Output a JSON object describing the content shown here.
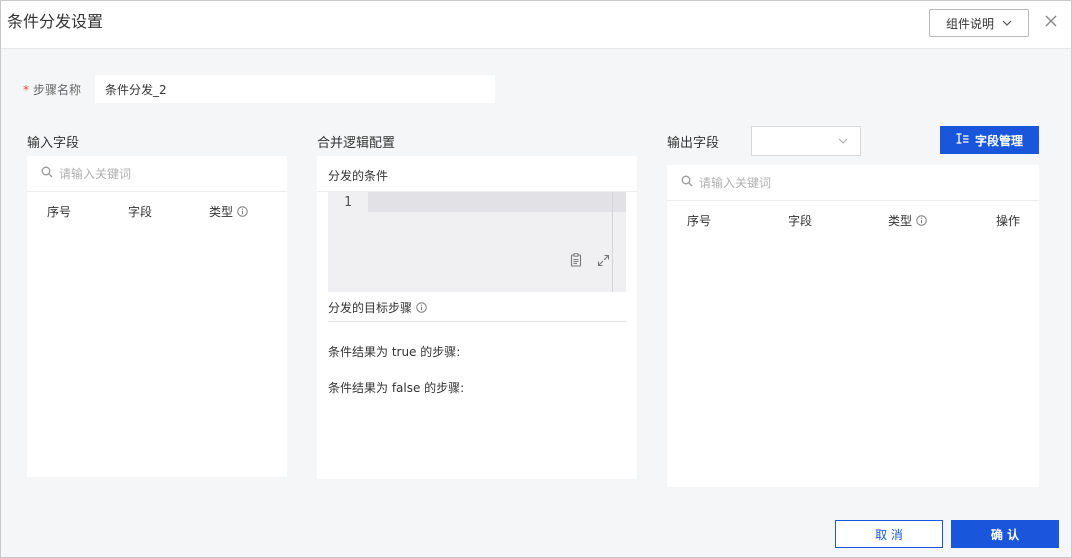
{
  "dialog": {
    "title": "条件分发设置",
    "help_label": "组件说明",
    "close_symbol": "✕"
  },
  "step": {
    "required_mark": "*",
    "label": "步骤名称",
    "value": "条件分发_2"
  },
  "input_fields": {
    "title": "输入字段",
    "search_placeholder": "请输入关键词",
    "columns": [
      "序号",
      "字段",
      "类型"
    ]
  },
  "merge_config": {
    "title": "合并逻辑配置",
    "condition_label": "分发的条件",
    "line_number": "1",
    "target_label": "分发的目标步骤",
    "true_label": "条件结果为 true 的步骤:",
    "false_label": "条件结果为 false 的步骤:"
  },
  "output_fields": {
    "title": "输出字段",
    "select_value": "",
    "manage_button": "字段管理",
    "search_placeholder": "请输入关键词",
    "columns": [
      "序号",
      "字段",
      "类型",
      "操作"
    ]
  },
  "footer": {
    "cancel": "取 消",
    "confirm": "确 认"
  },
  "colors": {
    "primary": "#1a56db",
    "required": "#e5484d",
    "background": "#f5f6f7"
  }
}
